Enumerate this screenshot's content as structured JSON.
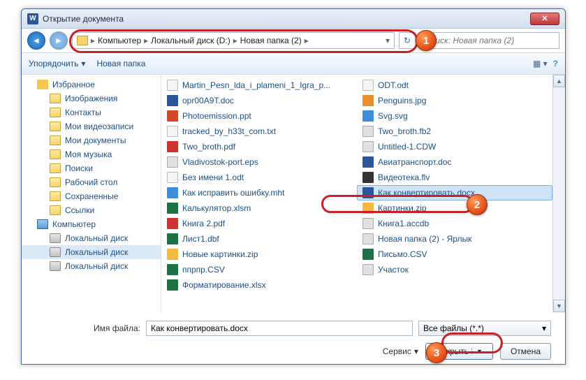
{
  "window": {
    "title": "Открытие документа"
  },
  "nav": {
    "breadcrumb": [
      "Компьютер",
      "Локальный диск (D:)",
      "Новая папка (2)"
    ],
    "search_placeholder": "Поиск: Новая папка (2)"
  },
  "toolbar": {
    "organize": "Упорядочить",
    "new_folder": "Новая папка"
  },
  "sidebar": {
    "items": [
      {
        "label": "Избранное",
        "icon": "star",
        "indent": false
      },
      {
        "label": "Изображения",
        "icon": "folder",
        "indent": true
      },
      {
        "label": "Контакты",
        "icon": "folder",
        "indent": true
      },
      {
        "label": "Мои видеозаписи",
        "icon": "folder",
        "indent": true
      },
      {
        "label": "Мои документы",
        "icon": "folder",
        "indent": true
      },
      {
        "label": "Моя музыка",
        "icon": "folder",
        "indent": true
      },
      {
        "label": "Поиски",
        "icon": "folder",
        "indent": true
      },
      {
        "label": "Рабочий стол",
        "icon": "folder",
        "indent": true
      },
      {
        "label": "Сохраненные",
        "icon": "folder",
        "indent": true
      },
      {
        "label": "Ссылки",
        "icon": "folder",
        "indent": true
      },
      {
        "label": "Компьютер",
        "icon": "comp",
        "indent": false
      },
      {
        "label": "Локальный диск",
        "icon": "drive",
        "indent": true
      },
      {
        "label": "Локальный диск",
        "icon": "drive",
        "indent": true,
        "sel": true
      },
      {
        "label": "Локальный диск",
        "icon": "drive",
        "indent": true
      }
    ]
  },
  "files_left": [
    {
      "name": "Martin_Pesn_lda_i_plameni_1_Igra_p...",
      "icon": "txt"
    },
    {
      "name": "opr00A9T.doc",
      "icon": "doc"
    },
    {
      "name": "Photoemission.ppt",
      "icon": "ppt"
    },
    {
      "name": "tracked_by_h33t_com.txt",
      "icon": "txt"
    },
    {
      "name": "Two_broth.pdf",
      "icon": "pdf"
    },
    {
      "name": "Vladivostok-port.eps",
      "icon": "gen"
    },
    {
      "name": "Без имени 1.odt",
      "icon": "txt"
    },
    {
      "name": "Как исправить ошибку.mht",
      "icon": "web"
    },
    {
      "name": "Калькулятор.xlsm",
      "icon": "xls"
    },
    {
      "name": "Книга 2.pdf",
      "icon": "pdf"
    },
    {
      "name": "Лист1.dbf",
      "icon": "xls"
    },
    {
      "name": "Новые картинки.zip",
      "icon": "zip"
    },
    {
      "name": "ппрпр.CSV",
      "icon": "xls"
    },
    {
      "name": "Форматирование.xlsx",
      "icon": "xls"
    }
  ],
  "files_right": [
    {
      "name": "ODT.odt",
      "icon": "txt"
    },
    {
      "name": "Penguins.jpg",
      "icon": "img"
    },
    {
      "name": "Svg.svg",
      "icon": "web"
    },
    {
      "name": "Two_broth.fb2",
      "icon": "gen"
    },
    {
      "name": "Untitled-1.CDW",
      "icon": "gen"
    },
    {
      "name": "Авиатранспорт.doc",
      "icon": "doc"
    },
    {
      "name": "Видеотека.flv",
      "icon": "vid"
    },
    {
      "name": "Как конвертировать.docx",
      "icon": "doc",
      "sel": true
    },
    {
      "name": "Картинки.zip",
      "icon": "zip"
    },
    {
      "name": "Книга1.accdb",
      "icon": "gen"
    },
    {
      "name": "Новая папка (2) - Ярлык",
      "icon": "gen"
    },
    {
      "name": "Письмо.CSV",
      "icon": "xls"
    },
    {
      "name": "Участок",
      "icon": "gen"
    }
  ],
  "bottom": {
    "filename_label": "Имя файла:",
    "filename_value": "Как конвертировать.docx",
    "filetype_value": "Все файлы (*.*)",
    "tools": "Сервис",
    "open": "Открыть",
    "cancel": "Отмена"
  },
  "annotations": {
    "b1": "1",
    "b2": "2",
    "b3": "3"
  }
}
